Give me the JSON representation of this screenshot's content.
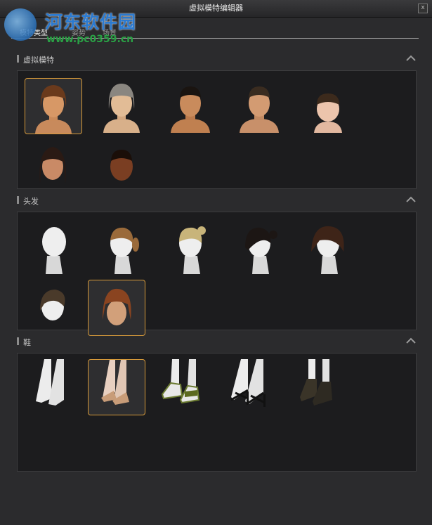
{
  "window": {
    "title": "虚拟模特编辑器",
    "close_glyph": "x"
  },
  "watermark": {
    "site_name": "河东软件园",
    "url": "www.pc0359.cn"
  },
  "tabs": [
    {
      "label": "模特类型",
      "active": true
    },
    {
      "label": "姿势",
      "active": false
    },
    {
      "label": "场景",
      "active": false
    }
  ],
  "sections": [
    {
      "title": "虚拟模特",
      "icon": "chevron-up-icon",
      "items": [
        "female-short-brown-hair",
        "female-gray-bob",
        "male-asian",
        "male-caucasian",
        "child-boy",
        "female-dark-hair",
        "male-dark-skin"
      ],
      "selected_index": 0
    },
    {
      "title": "头发",
      "icon": "chevron-up-icon",
      "items": [
        "bald",
        "ponytail-brown",
        "bun-blonde",
        "bun-black",
        "bob-dark-brown",
        "short-dark",
        "bob-auburn"
      ],
      "selected_index": 6
    },
    {
      "title": "鞋",
      "icon": "chevron-up-icon",
      "items": [
        "barefoot",
        "nude-heels",
        "green-sneakers",
        "black-strappy-sandals",
        "black-ankle-boots"
      ],
      "selected_index": 1
    }
  ],
  "colors": {
    "accent": "#d79a3a",
    "panel": "#1c1c1e",
    "background": "#2b2b2d"
  }
}
